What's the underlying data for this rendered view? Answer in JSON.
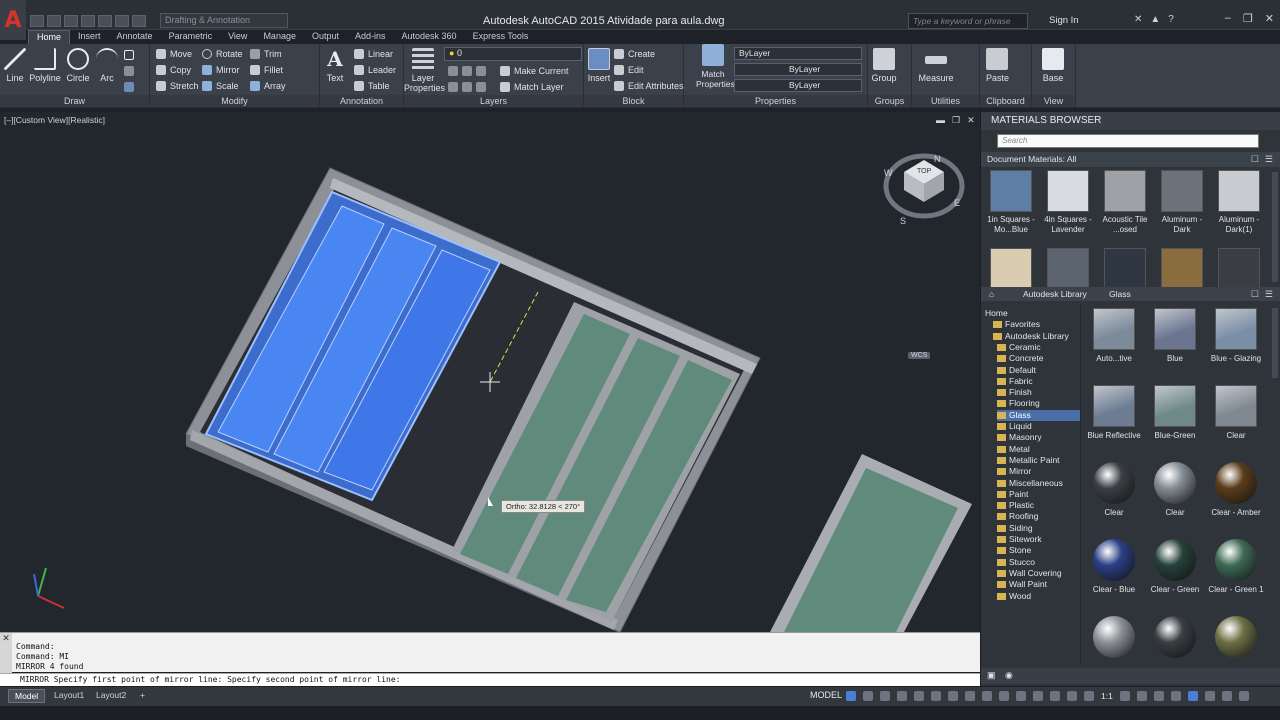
{
  "window": {
    "title": "Autodesk AutoCAD 2015    Atividade para aula.dwg",
    "workspace": "Drafting & Annotation",
    "search_placeholder": "Type a keyword or phrase",
    "signin": "Sign In"
  },
  "tabs": [
    "Home",
    "Insert",
    "Annotate",
    "Parametric",
    "View",
    "Manage",
    "Output",
    "Add-ins",
    "Autodesk 360",
    "Express Tools"
  ],
  "ribbon": {
    "draw": {
      "title": "Draw",
      "line": "Line",
      "polyline": "Polyline",
      "circle": "Circle",
      "arc": "Arc"
    },
    "modify": {
      "title": "Modify",
      "move": "Move",
      "rotate": "Rotate",
      "trim": "Trim",
      "copy": "Copy",
      "mirror": "Mirror",
      "fillet": "Fillet",
      "stretch": "Stretch",
      "scale": "Scale",
      "array": "Array"
    },
    "annotation": {
      "title": "Annotation",
      "text": "Text",
      "linear": "Linear",
      "leader": "Leader",
      "table": "Table"
    },
    "layers": {
      "title": "Layers",
      "layer_properties": "Layer Properties",
      "current_layer": "0",
      "make_current": "Make Current",
      "match_layer": "Match Layer"
    },
    "block": {
      "title": "Block",
      "insert": "Insert",
      "create": "Create",
      "edit": "Edit",
      "edit_attributes": "Edit Attributes"
    },
    "properties": {
      "title": "Properties",
      "match": "Match Properties",
      "color": "ByLayer",
      "linetype": "ByLayer",
      "lineweight": "ByLayer"
    },
    "groups": {
      "title": "Groups",
      "group": "Group"
    },
    "utilities": {
      "title": "Utilities",
      "measure": "Measure"
    },
    "clipboard": {
      "title": "Clipboard",
      "paste": "Paste"
    },
    "view": {
      "title": "View",
      "base": "Base"
    }
  },
  "viewport": {
    "label": "[–][Custom View][Realistic]",
    "tooltip": "Ortho: 32.8128 < 270°",
    "wcs": "WCS",
    "viewcube": {
      "top": "TOP",
      "n": "N",
      "s": "S",
      "e": "E",
      "w": "W"
    }
  },
  "materials_browser": {
    "title": "MATERIALS BROWSER",
    "search_placeholder": "Search",
    "doc_materials": "Document Materials: All",
    "doc_items": [
      {
        "label": "1in Squares - Mo...Blue",
        "color": "#5f7ea6"
      },
      {
        "label": "4in Squares - Lavender",
        "color": "#d9dbe2"
      },
      {
        "label": "Acoustic Tile ...osed",
        "color": "#9ea2a7"
      },
      {
        "label": "Aluminum - Dark",
        "color": "#6d727a"
      },
      {
        "label": "Aluminum - Dark(1)",
        "color": "#c8ccd1"
      },
      {
        "label": "",
        "color": "#d9ccb0"
      },
      {
        "label": "",
        "color": "#5b646e"
      },
      {
        "label": "",
        "color": "#2f3742"
      },
      {
        "label": "",
        "color": "#8a6d3f"
      },
      {
        "label": "",
        "color": "#3a3e44"
      }
    ],
    "breadcrumb": [
      "Autodesk Library",
      "Glass"
    ],
    "tree": [
      "Home",
      "Favorites",
      "Autodesk Library",
      "Ceramic",
      "Concrete",
      "Default",
      "Fabric",
      "Finish",
      "Flooring",
      "Glass",
      "Liquid",
      "Masonry",
      "Metal",
      "Metallic Paint",
      "Mirror",
      "Miscellaneous",
      "Paint",
      "Plastic",
      "Roofing",
      "Siding",
      "Sitework",
      "Stone",
      "Stucco",
      "Wall Covering",
      "Wall Paint",
      "Wood"
    ],
    "tree_selected": "Glass",
    "library_items": [
      {
        "label": "Auto...tive",
        "color": "#7d8a99"
      },
      {
        "label": "Blue",
        "color": "#6b7590"
      },
      {
        "label": "Blue - Glazing",
        "color": "#7a8ea6"
      },
      {
        "label": "Blue Reflective",
        "color": "#6d7c92"
      },
      {
        "label": "Blue-Green",
        "color": "#6f8a86"
      },
      {
        "label": "Clear",
        "color": "#7f8790"
      },
      {
        "label": "Clear",
        "color": "#3b3f44"
      },
      {
        "label": "Clear",
        "color": "#858c94"
      },
      {
        "label": "Clear - Amber",
        "color": "#5a3d1a"
      },
      {
        "label": "Clear - Blue",
        "color": "#2b3f86"
      },
      {
        "label": "Clear - Green",
        "color": "#27413a"
      },
      {
        "label": "Clear - Green 1",
        "color": "#3e6a55"
      },
      {
        "label": "",
        "color": "#8d9197"
      },
      {
        "label": "",
        "color": "#3a3d42"
      },
      {
        "label": "",
        "color": "#6d7045"
      }
    ]
  },
  "command": {
    "history": [
      "Command:",
      "Command: MI",
      "MIRROR 4 found"
    ],
    "prompt": "MIRROR Specify first point of mirror line: Specify second point of mirror line:"
  },
  "statusbar": {
    "layouts": [
      "Model",
      "Layout1",
      "Layout2"
    ],
    "model": "MODEL",
    "scale": "1:1"
  },
  "colors": {
    "accent": "#4a6ea8",
    "selection_blue": "#3f77e8",
    "glass_green": "#5f8a7c",
    "frame_gray": "#a9adb2"
  }
}
